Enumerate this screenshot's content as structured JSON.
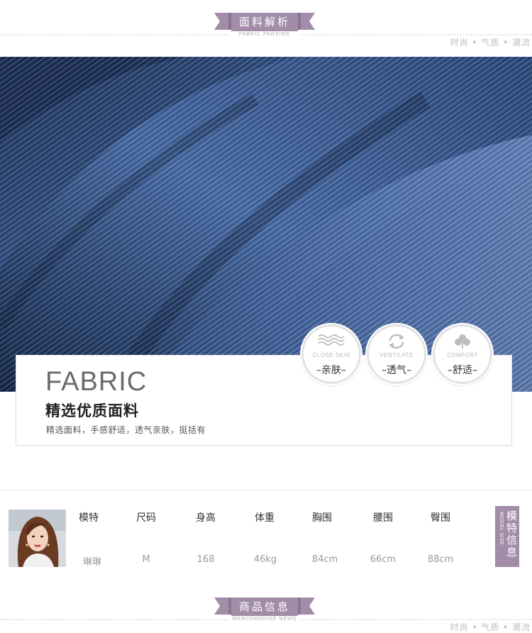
{
  "header_top": {
    "title": "面料解析",
    "subtitle": "FABRIC PARSING",
    "tagline": "时尚 • 气质 • 潮流"
  },
  "fabric_card": {
    "heading": "FABRIC",
    "title": "精选优质面料",
    "description": "精选面料，手感舒适，透气亲肤，挺括有"
  },
  "features": [
    {
      "icon": "waves-icon",
      "en": "CLOSE SKIN",
      "cn": "–亲肤–"
    },
    {
      "icon": "refresh-arrows-icon",
      "en": "VENTILATE",
      "cn": "–透气–"
    },
    {
      "icon": "clover-icon",
      "en": "COMFORT",
      "cn": "–舒适–"
    }
  ],
  "model_info": {
    "headers": [
      "模特",
      "尺码",
      "身高",
      "体重",
      "胸围",
      "腰围",
      "臀围"
    ],
    "values": [
      "琳琳",
      "M",
      "168",
      "46kg",
      "84cm",
      "66cm",
      "88cm"
    ],
    "badge_cn": "模特信息",
    "badge_en": "MODEL SIZE"
  },
  "header_bottom": {
    "title": "商品信息",
    "subtitle": "MERCHANDISE NEWS",
    "tagline": "时尚 • 气质 • 潮流"
  },
  "colors": {
    "ribbon": "#a28ca8",
    "denim": "#2c4a7a"
  }
}
